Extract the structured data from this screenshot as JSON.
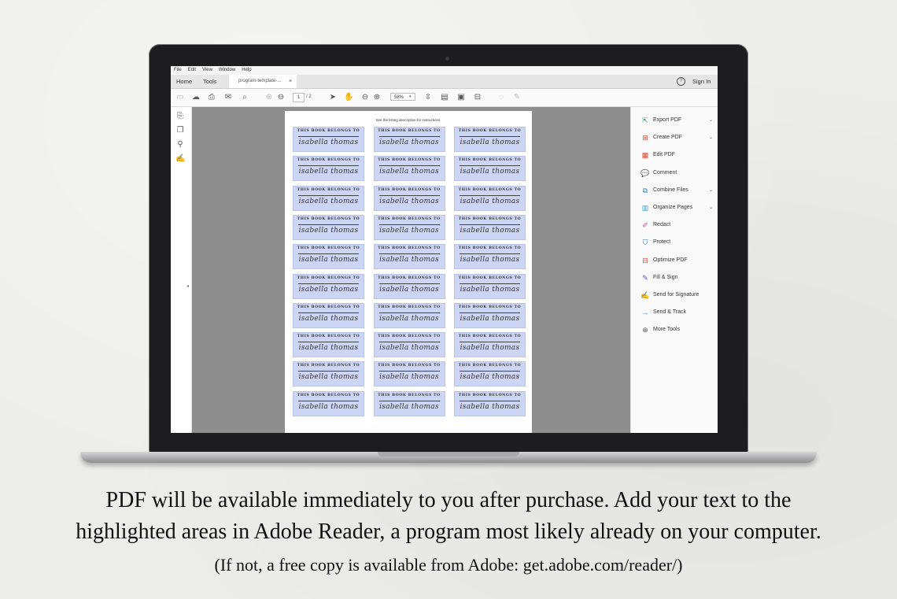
{
  "menu": [
    "File",
    "Edit",
    "View",
    "Window",
    "Help"
  ],
  "tabs": {
    "home": "Home",
    "tools": "Tools",
    "document": "program-template-...",
    "close": "×"
  },
  "header": {
    "help": "?",
    "signin": "Sign In"
  },
  "toolbar": {
    "page_current": "1",
    "page_total": "/ 2",
    "zoom": "58%",
    "icons": [
      "save-icon",
      "upload-icon",
      "print-icon",
      "email-icon",
      "search-icon",
      "page-up-icon",
      "page-down-icon",
      "select-cursor-icon",
      "hand-icon",
      "zoom-out-icon",
      "zoom-in-icon",
      "fit-page-icon",
      "scroll-mode-icon",
      "fullscreen-icon",
      "read-mode-icon",
      "comment-icon",
      "pen-icon"
    ]
  },
  "leftrail": [
    "page-thumbnails-icon",
    "copy-icon",
    "attachment-icon",
    "signature-icon"
  ],
  "document": {
    "note": "See the listing description for instructions.",
    "label_top": "THIS BOOK BELONGS TO",
    "label_name": "isabella thomas",
    "rows": 10,
    "cols": 3
  },
  "rightpanel": {
    "items": [
      {
        "label": "Export PDF",
        "icon": "export-pdf-icon",
        "color": "#2e9c6e",
        "chevron": true
      },
      {
        "label": "Create PDF",
        "icon": "create-pdf-icon",
        "color": "#d9442b",
        "chevron": true
      },
      {
        "label": "Edit PDF",
        "icon": "edit-pdf-icon",
        "color": "#d9442b",
        "chevron": false
      },
      {
        "label": "Comment",
        "icon": "comment-icon",
        "color": "#e8b100",
        "chevron": false
      },
      {
        "label": "Combine Files",
        "icon": "combine-files-icon",
        "color": "#2a7fd4",
        "chevron": true
      },
      {
        "label": "Organize Pages",
        "icon": "organize-pages-icon",
        "color": "#2aa6c8",
        "chevron": true
      },
      {
        "label": "Redact",
        "icon": "redact-icon",
        "color": "#c44f9b",
        "chevron": false
      },
      {
        "label": "Protect",
        "icon": "protect-icon",
        "color": "#2a6fd4",
        "chevron": false
      },
      {
        "label": "Optimize PDF",
        "icon": "optimize-pdf-icon",
        "color": "#d9442b",
        "chevron": false
      },
      {
        "label": "Fill & Sign",
        "icon": "fill-sign-icon",
        "color": "#6a4fc4",
        "chevron": false
      },
      {
        "label": "Send for Signature",
        "icon": "send-signature-icon",
        "color": "#6a4fc4",
        "chevron": false
      },
      {
        "label": "Send & Track",
        "icon": "send-track-icon",
        "color": "#2a7fd4",
        "chevron": false
      },
      {
        "label": "More Tools",
        "icon": "more-tools-icon",
        "color": "#555555",
        "chevron": false
      }
    ]
  },
  "caption": {
    "line1": "PDF will be available immediately to you after purchase.  Add your text to the",
    "line2": "highlighted areas in Adobe Reader, a program most likely already on your computer.",
    "line3": "(If not, a free copy is available from Adobe: get.adobe.com/reader/)"
  }
}
